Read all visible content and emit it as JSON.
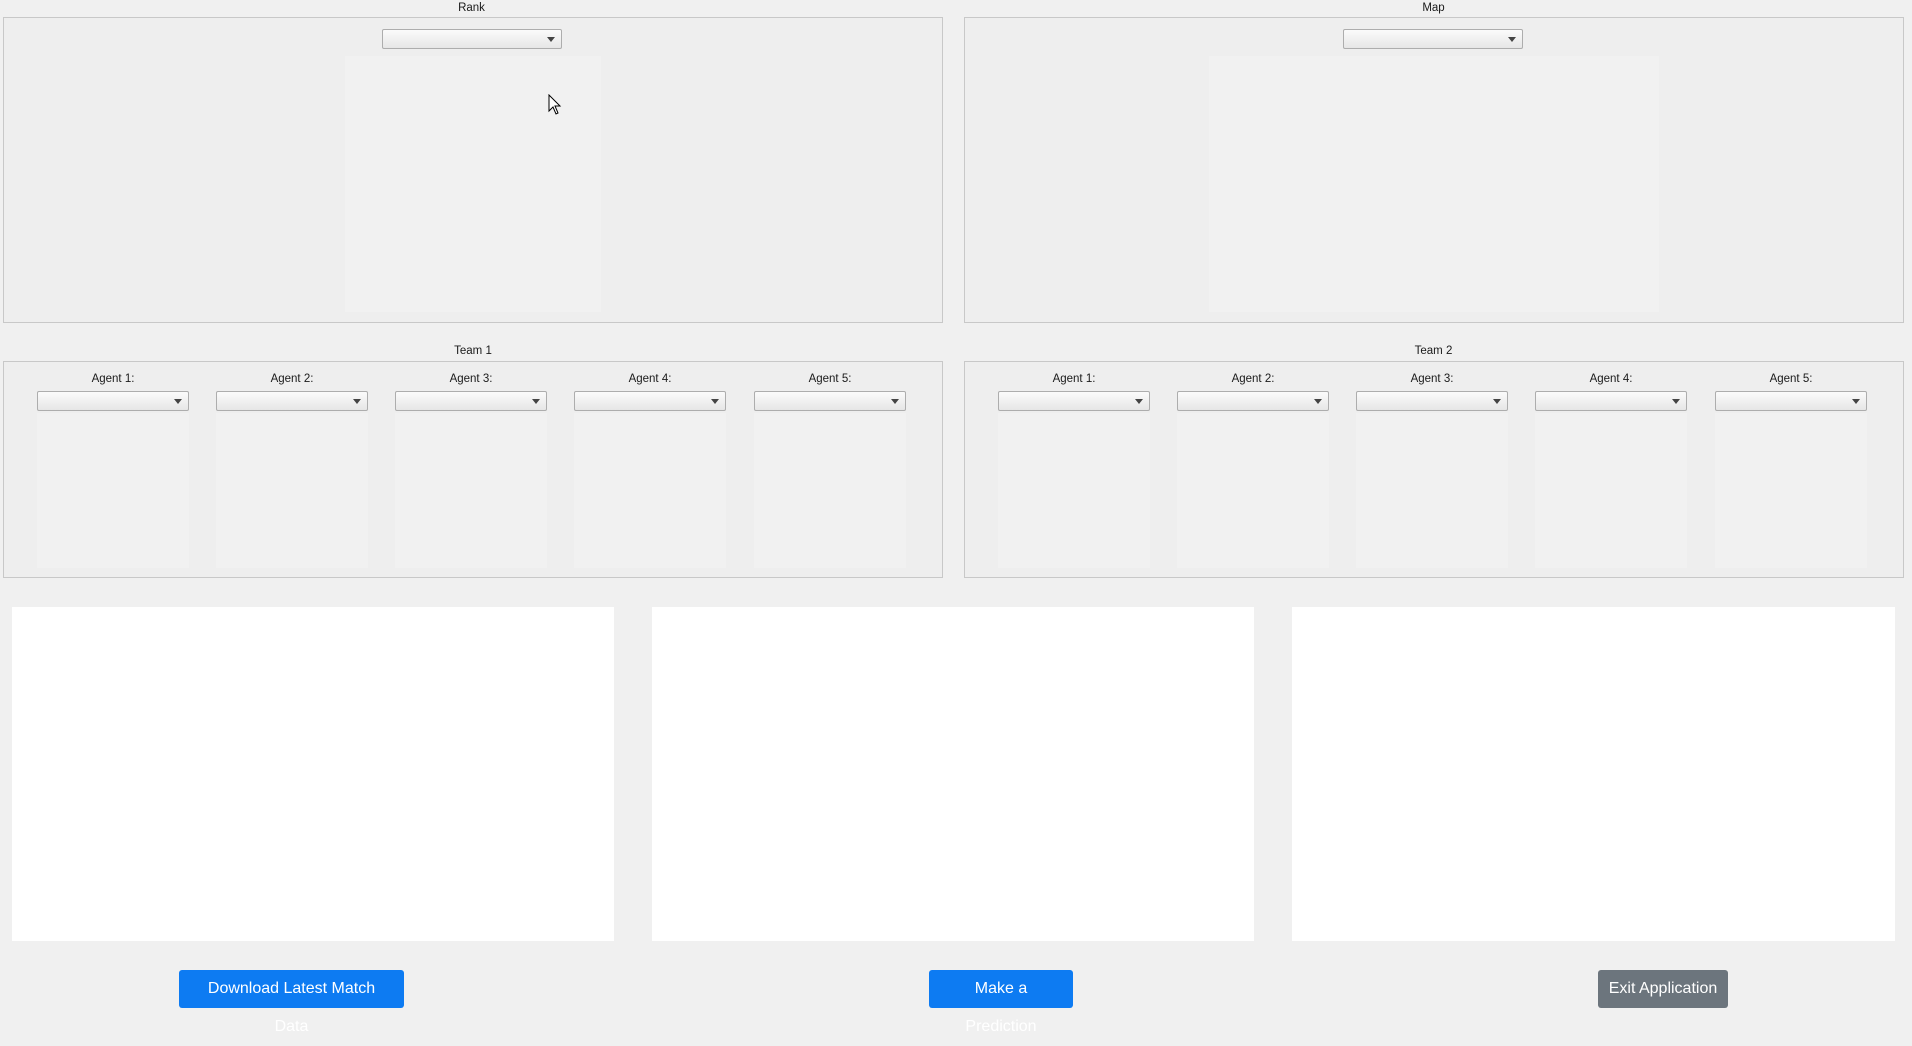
{
  "rank": {
    "title": "Rank",
    "selected": ""
  },
  "map": {
    "title": "Map",
    "selected": ""
  },
  "team1": {
    "title": "Team 1",
    "agents": [
      {
        "label": "Agent 1:",
        "selected": ""
      },
      {
        "label": "Agent 2:",
        "selected": ""
      },
      {
        "label": "Agent 3:",
        "selected": ""
      },
      {
        "label": "Agent 4:",
        "selected": ""
      },
      {
        "label": "Agent 5:",
        "selected": ""
      }
    ]
  },
  "team2": {
    "title": "Team 2",
    "agents": [
      {
        "label": "Agent 1:",
        "selected": ""
      },
      {
        "label": "Agent 2:",
        "selected": ""
      },
      {
        "label": "Agent 3:",
        "selected": ""
      },
      {
        "label": "Agent 4:",
        "selected": ""
      },
      {
        "label": "Agent 5:",
        "selected": ""
      }
    ]
  },
  "buttons": {
    "download_label": "Download Latest Match Data",
    "predict_label": "Make a Prediction",
    "exit_label": "Exit Application"
  },
  "colors": {
    "primary_button": "#0d7bf2",
    "exit_button": "#6c757d",
    "window_bg": "#f0f0f0",
    "plot_bg": "#ffffff"
  },
  "icons": {
    "dropdown": "chevron-down-icon",
    "cursor": "mouse-pointer-icon"
  }
}
